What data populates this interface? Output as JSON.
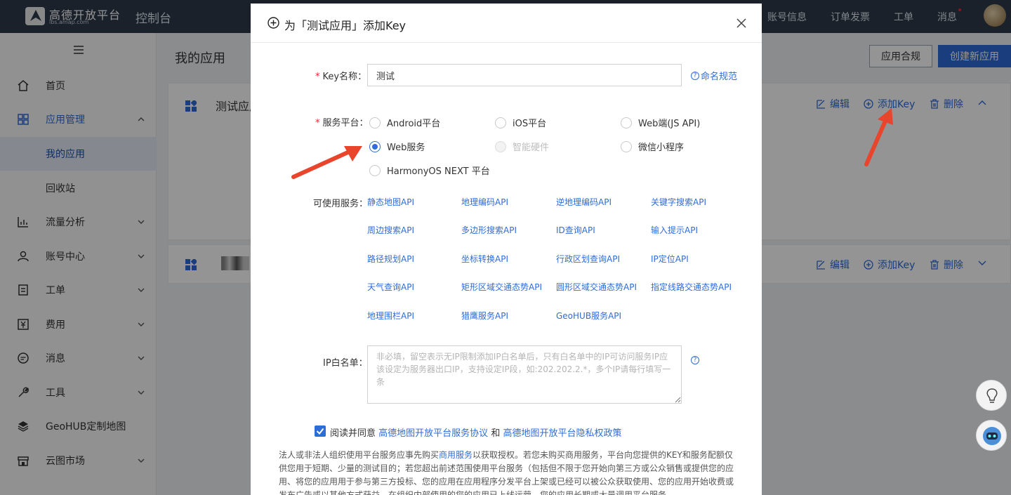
{
  "header": {
    "logo_title": "高德开放平台",
    "logo_sub": "lbs.amap.com",
    "console": "控制台",
    "nav": [
      "账号信息",
      "订单发票",
      "工单",
      "消息"
    ]
  },
  "sidebar": {
    "items": [
      {
        "label": "首页",
        "icon": "home-icon"
      },
      {
        "label": "应用管理",
        "icon": "apps-icon"
      },
      {
        "label": "流量分析",
        "icon": "chart-icon"
      },
      {
        "label": "账号中心",
        "icon": "user-icon"
      },
      {
        "label": "工单",
        "icon": "ticket-icon"
      },
      {
        "label": "费用",
        "icon": "money-icon"
      },
      {
        "label": "消息",
        "icon": "message-icon"
      },
      {
        "label": "工具",
        "icon": "tool-icon"
      },
      {
        "label": "GeoHUB定制地图",
        "icon": "layers-icon"
      },
      {
        "label": "云图市场",
        "icon": "store-icon"
      }
    ],
    "sub_items": [
      "我的应用",
      "回收站"
    ]
  },
  "main": {
    "title": "我的应用",
    "compliance_button": "应用合规",
    "create_button": "创建新应用",
    "apps": [
      {
        "name": "测试应用",
        "edit": "编辑",
        "add_key": "添加Key",
        "delete": "删除"
      },
      {
        "name": "",
        "edit": "编辑",
        "add_key": "添加Key",
        "delete": "删除"
      }
    ]
  },
  "modal": {
    "title": "为「测试应用」添加Key",
    "key_name_label": "Key名称：",
    "key_name_value": "测试",
    "naming_rules": "命名规范",
    "platform_label": "服务平台：",
    "platforms": [
      {
        "label": "Android平台",
        "state": "unchecked"
      },
      {
        "label": "iOS平台",
        "state": "unchecked"
      },
      {
        "label": "Web端(JS API)",
        "state": "unchecked"
      },
      {
        "label": "Web服务",
        "state": "checked"
      },
      {
        "label": "智能硬件",
        "state": "disabled"
      },
      {
        "label": "微信小程序",
        "state": "unchecked"
      },
      {
        "label": "HarmonyOS NEXT 平台",
        "state": "unchecked"
      }
    ],
    "services_label": "可使用服务：",
    "services": [
      "静态地图API",
      "地理编码API",
      "逆地理编码API",
      "关键字搜索API",
      "周边搜索API",
      "多边形搜索API",
      "ID查询API",
      "输入提示API",
      "路径规划API",
      "坐标转换API",
      "行政区划查询API",
      "IP定位API",
      "天气查询API",
      "矩形区域交通态势API",
      "圆形区域交通态势API",
      "指定线路交通态势API",
      "地理围栏API",
      "猎鹰服务API",
      "GeoHUB服务API"
    ],
    "ip_label": "IP白名单：",
    "ip_placeholder": "非必填，留空表示无IP限制添加IP白名单后，只有白名单中的IP可访问服务IP应该设定为服务器出口IP，支持设定IP段，如:202.202.2.*，多个IP请每行填写一条",
    "agree_prefix": "阅读并同意",
    "agree_link1": "高德地图开放平台服务协议",
    "agree_and": "和",
    "agree_link2": "高德地图开放平台隐私权政策",
    "notice_before": "法人或非法人组织使用平台服务应事先购买",
    "notice_link": "商用服务",
    "notice_after": "以获取授权。若您未购买商用服务，平台向您提供的KEY和服务配额仅供您用于短期、少量的测试目的；若您超出前述范围使用平台服务（包括但不限于您开始向第三方或公众销售或提供您的应用、将您的应用用于参与第三方投标、您的应用在应用程序分发平台上架或已经可以被公众获取使用、您的应用开始收费或发布广告或以其他方式获益、在组织内部使用的您的应用已上线运营、您的应用长期或大量调用平台服务"
  },
  "colors": {
    "accent": "#2e6cd8",
    "topbar": "#2d3a4b",
    "required": "#f5222d",
    "arrow": "#e8452c"
  }
}
